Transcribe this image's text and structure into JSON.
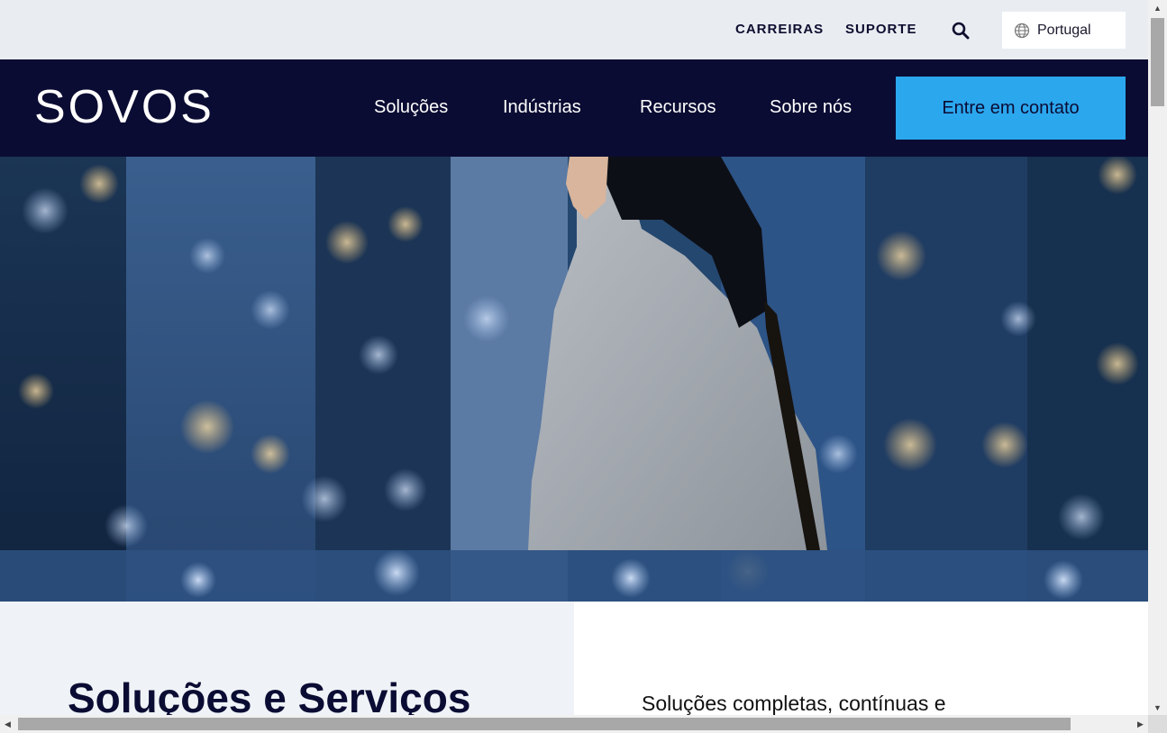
{
  "utility": {
    "careers": "CARREIRAS",
    "support": "SUPORTE",
    "search_icon": "search-icon",
    "language": "Portugal",
    "globe_icon": "globe-icon"
  },
  "nav": {
    "logo": "SOVOS",
    "items": [
      {
        "label": "Soluções"
      },
      {
        "label": "Indústrias"
      },
      {
        "label": "Recursos"
      },
      {
        "label": "Sobre nós"
      }
    ],
    "cta": "Entre em contato"
  },
  "hero": {
    "image_alt": ""
  },
  "content": {
    "title": "Soluções e Serviços",
    "text": "Soluções completas, contínuas e"
  },
  "colors": {
    "utility_bg": "#e9edf1",
    "nav_bg": "#0b0c33",
    "cta_bg": "#2ba7ee",
    "section_bg": "#eff3f7"
  }
}
